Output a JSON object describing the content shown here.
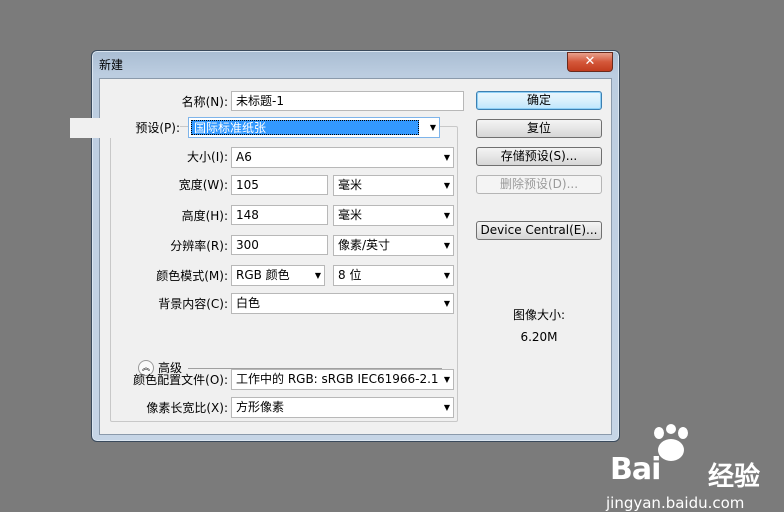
{
  "dialog": {
    "title": "新建",
    "close_symbol": "✕"
  },
  "form": {
    "name_label": "名称(N):",
    "name_value": "未标题-1",
    "preset_label": "预设(P):",
    "preset_value": "国际标准纸张",
    "size_label": "大小(I):",
    "size_value": "A6",
    "width_label": "宽度(W):",
    "width_value": "105",
    "width_unit": "毫米",
    "height_label": "高度(H):",
    "height_value": "148",
    "height_unit": "毫米",
    "resolution_label": "分辨率(R):",
    "resolution_value": "300",
    "resolution_unit": "像素/英寸",
    "color_mode_label": "颜色模式(M):",
    "color_mode_value": "RGB 颜色",
    "bit_depth_value": "8 位",
    "background_label": "背景内容(C):",
    "background_value": "白色",
    "advanced_label": "高级",
    "color_profile_label": "颜色配置文件(O):",
    "color_profile_value": "工作中的 RGB: sRGB IEC61966-2.1",
    "pixel_aspect_label": "像素长宽比(X):",
    "pixel_aspect_value": "方形像素"
  },
  "buttons": {
    "ok": "确定",
    "reset": "复位",
    "save_preset": "存储预设(S)...",
    "delete_preset": "删除预设(D)...",
    "device_central": "Device Central(E)..."
  },
  "image_info": {
    "label": "图像大小:",
    "value": "6.20M"
  },
  "watermark": {
    "brand": "Bai",
    "brand_suffix": "经验",
    "url": "jingyan.baidu.com"
  }
}
